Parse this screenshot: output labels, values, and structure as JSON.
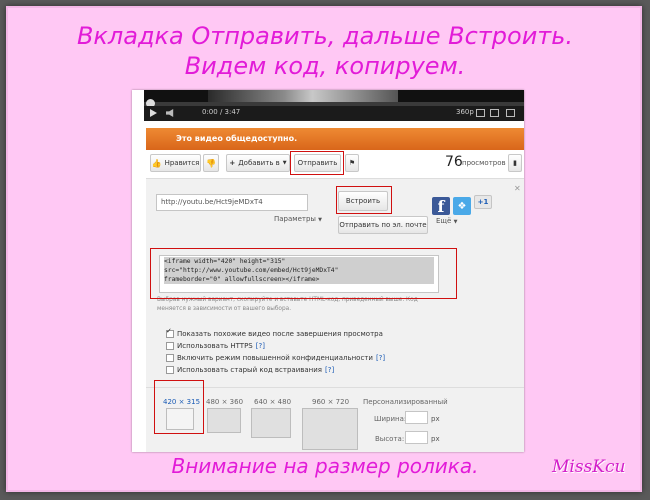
{
  "caption": {
    "line1": "Вкладка Отправить, дальше Встроить.",
    "line2": "Видем код, копируем.",
    "bottom": "Внимание на размер ролика.",
    "signature": "MissKcu"
  },
  "player": {
    "time": "0:00 / 3:47",
    "quality": "360p"
  },
  "notice": "Это видео общедоступно.",
  "actions": {
    "like": "Нравится",
    "add_to": "Добавить в",
    "share": "Отправить",
    "views_count": "76",
    "views_label": "просмотров"
  },
  "share_panel": {
    "url": "http://youtu.be/Hct9jeMDxT4",
    "params": "Параметры",
    "embed_button": "Встроить",
    "email_button": "Отправить по эл. почте",
    "more": "Ещё",
    "gplus": "+1",
    "embed_code": "<iframe width=\"420\" height=\"315\"\nsrc=\"http://www.youtube.com/embed/Hct9jeMDxT4\"\nframeborder=\"0\" allowfullscreen></iframe>",
    "help_text": "Выбрав нужный вариант, скопируйте и вставьте HTML-код, приведенный выше. Код меняется в зависимости от вашего выбора.",
    "options": [
      {
        "label": "Показать похожие видео после завершения просмотра",
        "checked": true,
        "help": ""
      },
      {
        "label": "Использовать HTTPS",
        "checked": false,
        "help": "[?]"
      },
      {
        "label": "Включить режим повышенной конфиденциальности",
        "checked": false,
        "help": "[?]"
      },
      {
        "label": "Использовать старый код встраивания",
        "checked": false,
        "help": "[?]"
      }
    ],
    "sizes": [
      "420 × 315",
      "480 × 360",
      "640 × 480",
      "960 × 720"
    ],
    "custom_label": "Персонализированный",
    "width_label": "Ширина:",
    "height_label": "Высота:",
    "unit": "px"
  },
  "colors": {
    "caption": "#e21bd8",
    "background": "#ffc8f4",
    "notice_bar": "#e0731f",
    "highlight": "#d01010"
  }
}
